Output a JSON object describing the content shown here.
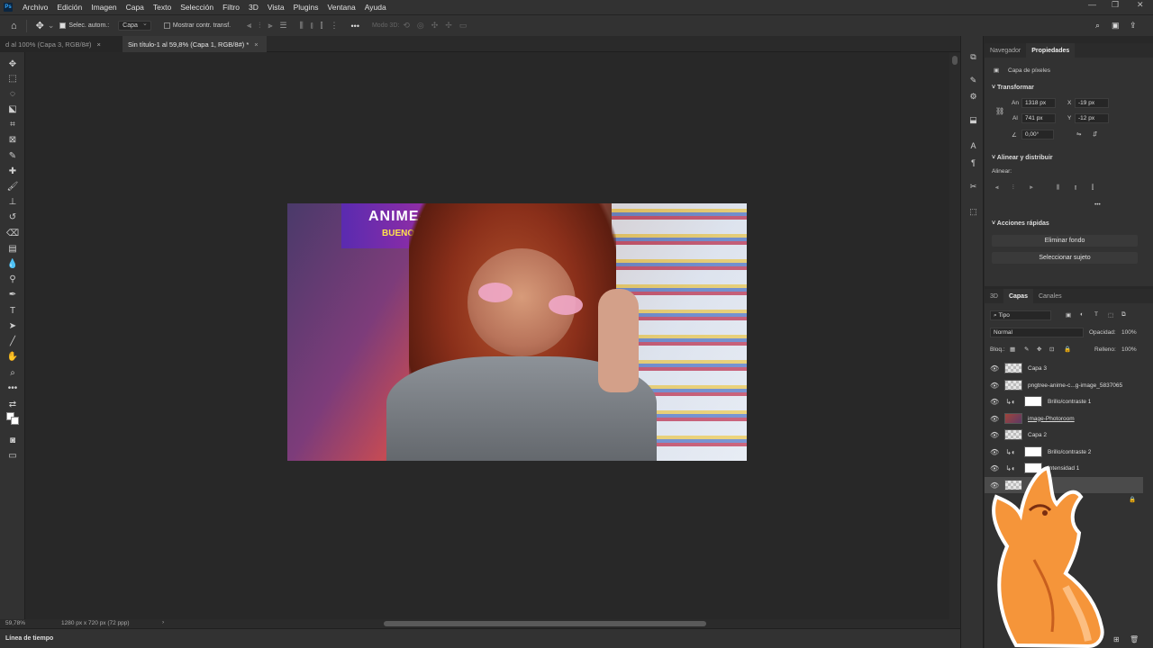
{
  "app": {
    "logo": "Ps"
  },
  "menubar": {
    "items": [
      "Archivo",
      "Edición",
      "Imagen",
      "Capa",
      "Texto",
      "Selección",
      "Filtro",
      "3D",
      "Vista",
      "Plugins",
      "Ventana",
      "Ayuda"
    ]
  },
  "options_bar": {
    "auto_select_label": "Selec. autom.:",
    "auto_select_value": "Capa",
    "show_transform_label": "Mostrar contr. transf.",
    "mode_3d_label": "Modo 3D:"
  },
  "doc_tabs": [
    {
      "title": "d al 100% (Capa 3, RGB/8#)",
      "active": false
    },
    {
      "title": "Sin título-1 al 59,8% (Capa 1, RGB/8#) *",
      "active": true
    }
  ],
  "canvas": {
    "banner_text": "ANIME-CO",
    "banner_subtext": "BUENOS AIRES"
  },
  "status": {
    "zoom": "59,78%",
    "doc_info": "1280 px x 720 px (72 ppp)"
  },
  "timeline": {
    "label": "Línea de tiempo"
  },
  "properties_panel": {
    "tabs": [
      "Navegador",
      "Propiedades"
    ],
    "active_tab": "Propiedades",
    "layer_kind": "Capa de píxeles",
    "transform": {
      "title": "Transformar",
      "width_label": "An",
      "width": "1318 px",
      "height_label": "Al",
      "height": "741 px",
      "x_label": "X",
      "x": "-19 px",
      "y_label": "Y",
      "y": "-12 px",
      "angle": "0,00°"
    },
    "align": {
      "title": "Alinear y distribuir",
      "label": "Alinear:"
    },
    "quick_actions": {
      "title": "Acciones rápidas",
      "remove_bg": "Eliminar fondo",
      "select_subject": "Seleccionar sujeto"
    }
  },
  "layers_panel": {
    "tabs": [
      "3D",
      "Capas",
      "Canales"
    ],
    "active_tab": "Capas",
    "filter_kind": "Tipo",
    "blend_mode": "Normal",
    "opacity_label": "Opacidad:",
    "opacity": "100%",
    "lock_label": "Bloq.:",
    "fill_label": "Relleno:",
    "fill": "100%",
    "layers": [
      {
        "name": "Capa 3",
        "kind": "pixel"
      },
      {
        "name": "pngtree-anime-c...g-image_5837065",
        "kind": "pixel"
      },
      {
        "name": "Brillo/contraste 1",
        "kind": "adjustment"
      },
      {
        "name": "image-Photoroom",
        "kind": "photo"
      },
      {
        "name": "Capa 2",
        "kind": "pixel"
      },
      {
        "name": "Brillo/contraste 2",
        "kind": "adjustment"
      },
      {
        "name": "Intensidad 1",
        "kind": "adjustment"
      },
      {
        "name": "",
        "kind": "selected"
      }
    ]
  },
  "colors": {
    "accent": "#31a8ff",
    "panel": "#323232",
    "canvas_bg": "#282828"
  }
}
